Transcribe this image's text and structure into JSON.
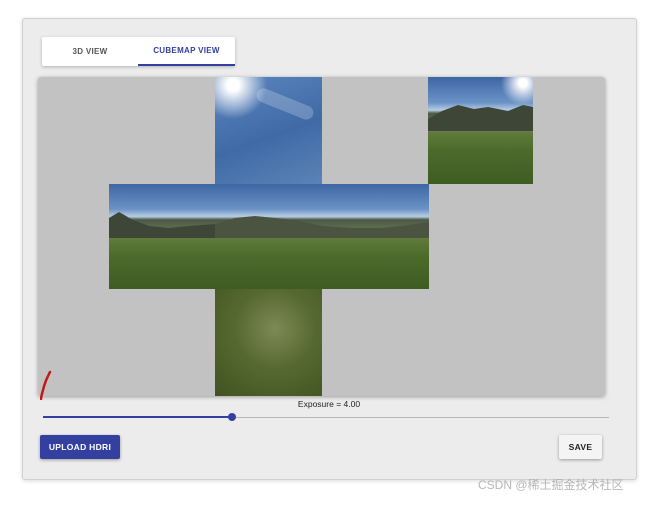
{
  "tabs": [
    {
      "label": "3D VIEW",
      "active": false
    },
    {
      "label": "CUBEMAP VIEW",
      "active": true
    }
  ],
  "viewer": {
    "faces": [
      "top",
      "left",
      "front",
      "right",
      "back",
      "bottom"
    ],
    "background_color": "#c2c2c2"
  },
  "exposure": {
    "label": "Exposure = 4.00",
    "slider_value_fraction": 0.334
  },
  "buttons": {
    "upload_label": "UPLOAD HDRI",
    "save_label": "SAVE"
  },
  "colors": {
    "accent": "#3340a0",
    "card_background": "#ececec"
  },
  "watermark": "CSDN @稀土掘金技术社区"
}
